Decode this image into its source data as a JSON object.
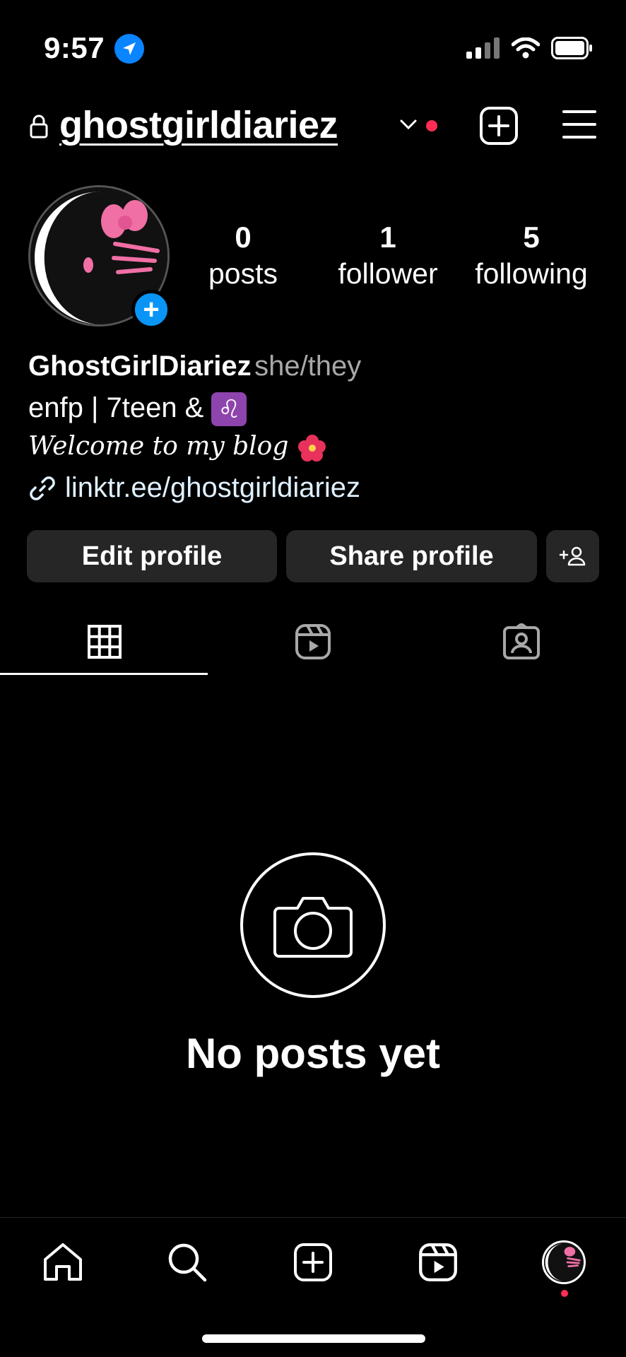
{
  "status_bar": {
    "time": "9:57"
  },
  "header": {
    "username": "ghostgirldiariez"
  },
  "stats": [
    {
      "value": "0",
      "label": "posts"
    },
    {
      "value": "1",
      "label": "follower"
    },
    {
      "value": "5",
      "label": "following"
    }
  ],
  "bio": {
    "name": "GhostGirlDiariez",
    "pronouns": "she/they",
    "line1": "enfp | 7teen &",
    "leo_symbol": "♌",
    "line2": "Welcome to my blog",
    "link": "linktr.ee/ghostgirldiariez"
  },
  "buttons": {
    "edit": "Edit profile",
    "share": "Share profile"
  },
  "empty_state": {
    "title": "No posts yet"
  },
  "colors": {
    "background": "#000000",
    "button_bg": "#262626",
    "accent_blue": "#0a95f6",
    "notification_red": "#ff2d55",
    "pronoun_gray": "#a8a8a8",
    "link_color": "#e0f1ff"
  },
  "icons": {
    "tabs": [
      "grid-icon",
      "reels-icon",
      "tagged-icon"
    ],
    "nav": [
      "home-icon",
      "search-icon",
      "create-icon",
      "reels-icon",
      "profile-avatar"
    ]
  }
}
